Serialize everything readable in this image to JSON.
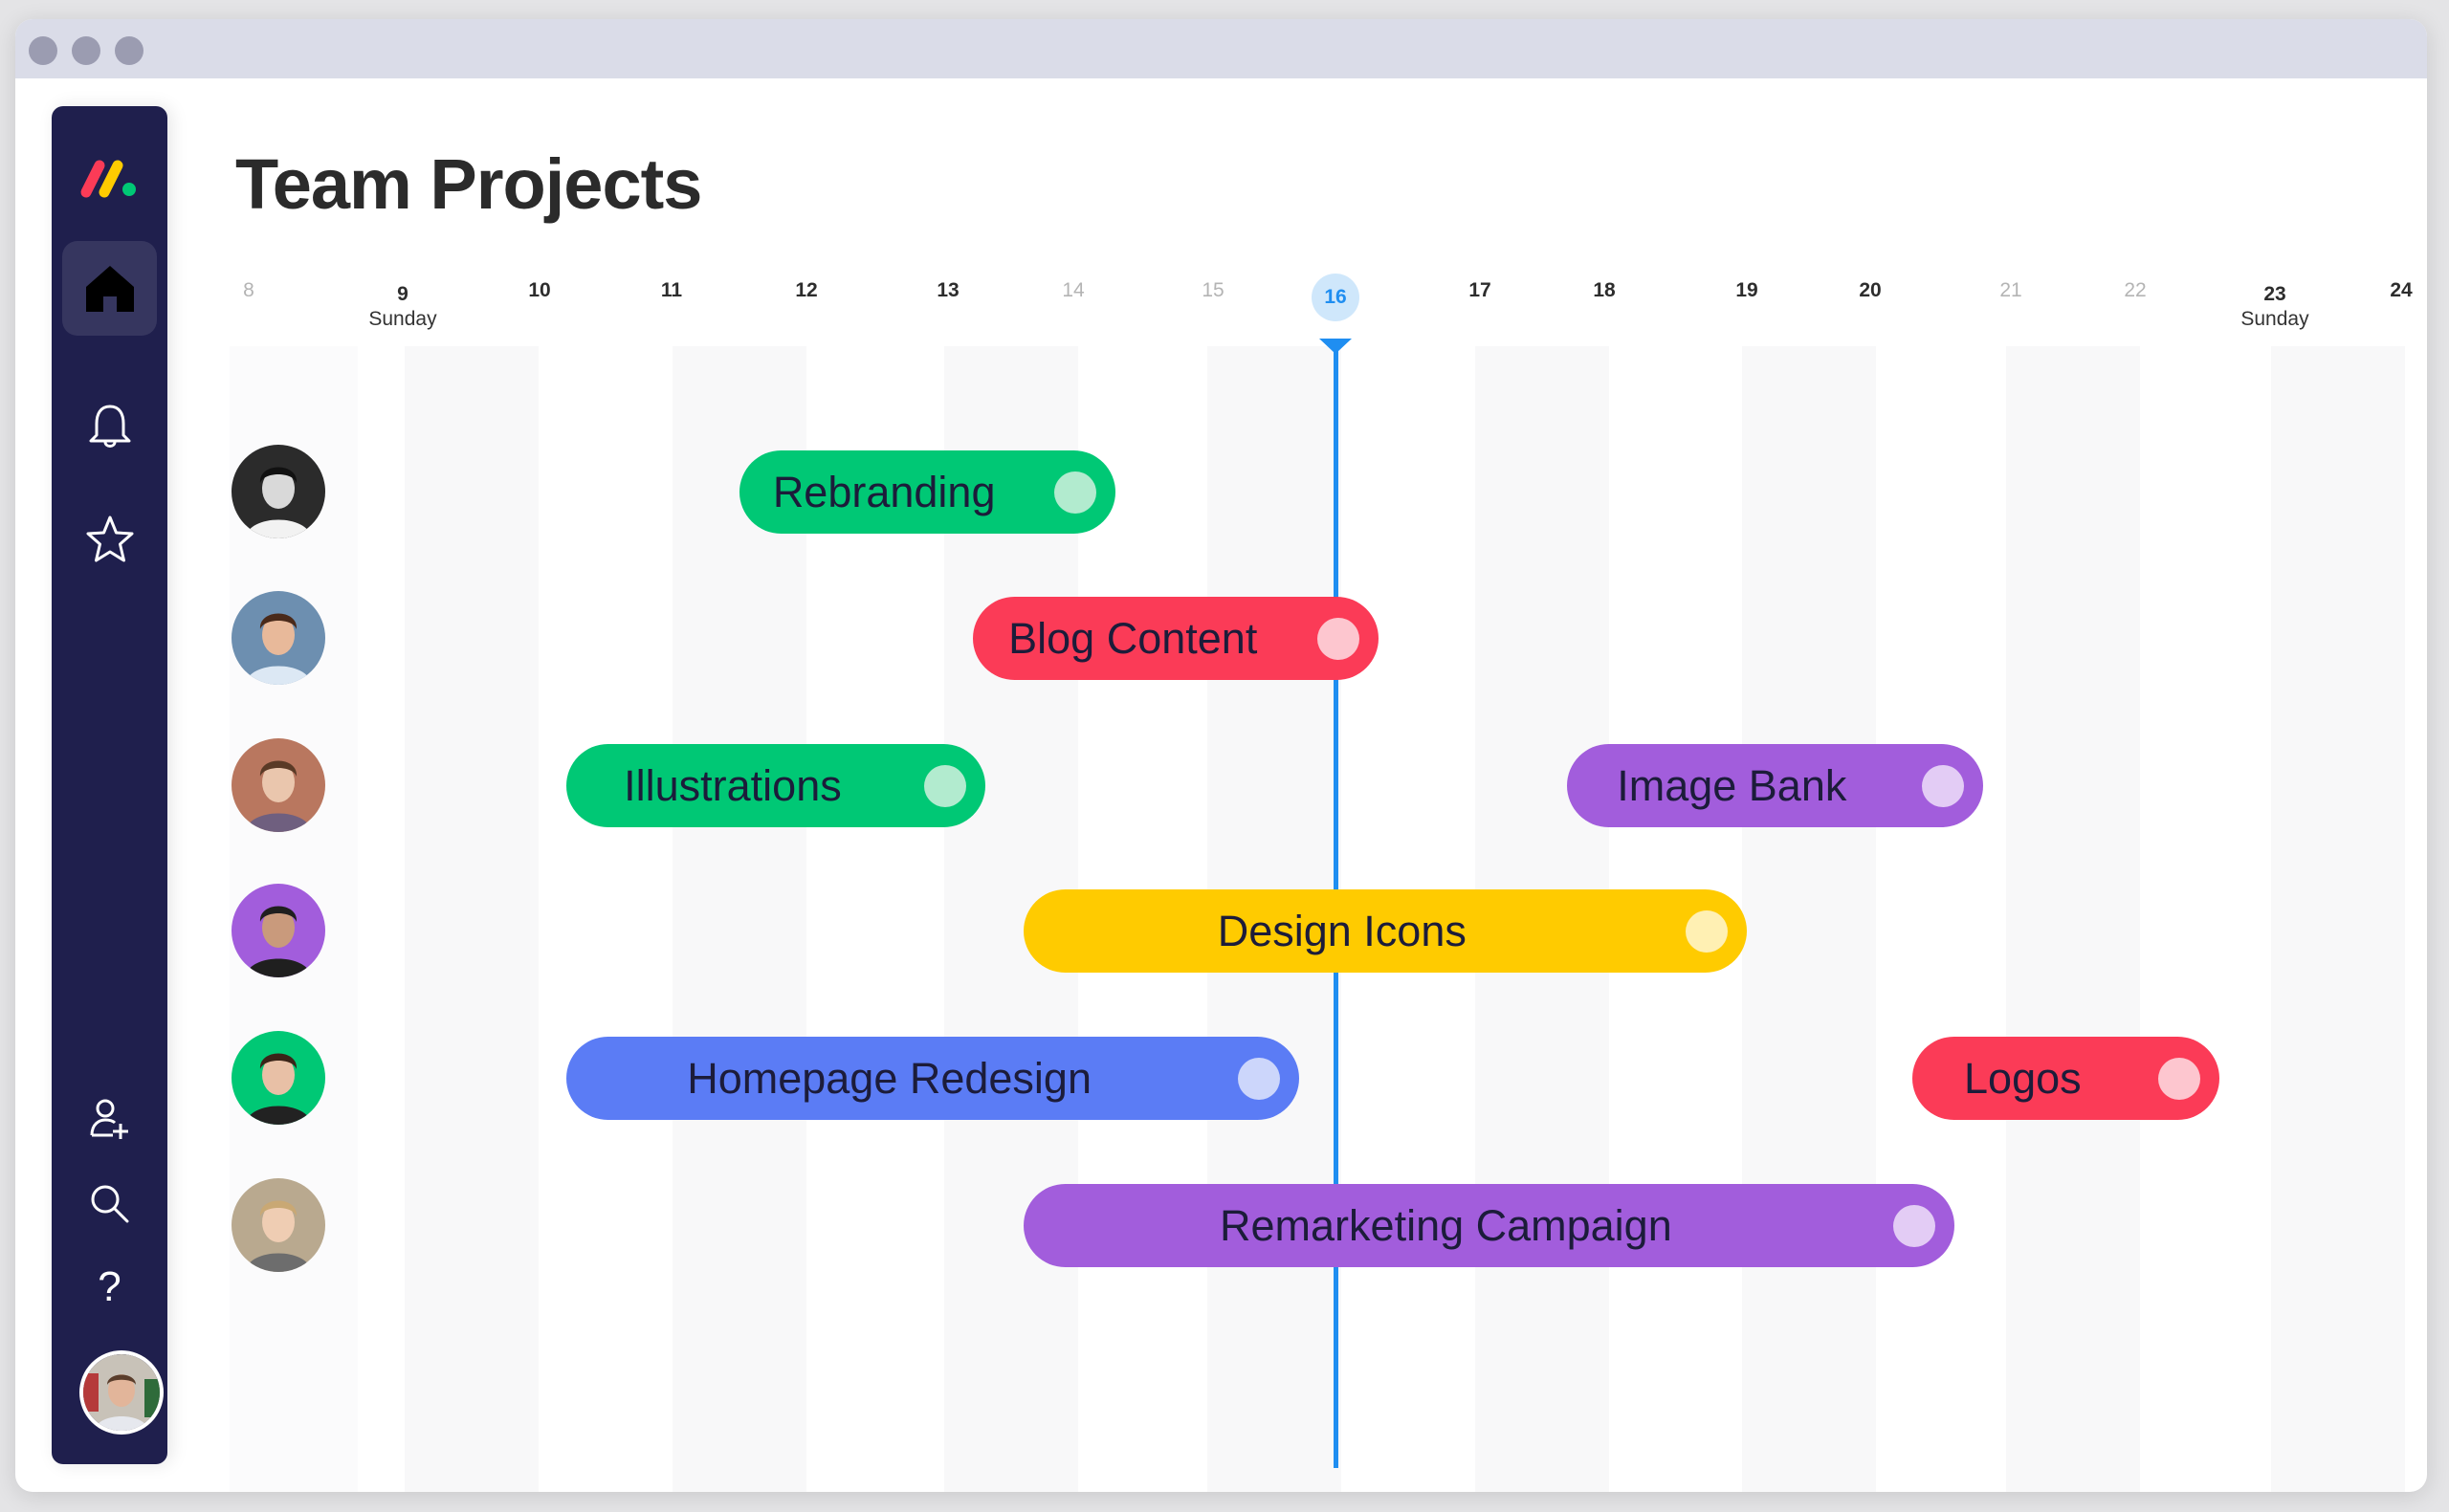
{
  "window": {
    "traffic_lights": [
      "close",
      "minimize",
      "maximize"
    ]
  },
  "sidebar": {
    "logo": "monday-logo",
    "top_items": [
      {
        "name": "home",
        "icon": "home-icon",
        "active": true
      },
      {
        "name": "notifications",
        "icon": "bell-icon",
        "active": false
      },
      {
        "name": "favorites",
        "icon": "star-icon",
        "active": false
      }
    ],
    "bottom_items": [
      {
        "name": "invite-members",
        "icon": "user-plus-icon"
      },
      {
        "name": "search",
        "icon": "search-icon"
      },
      {
        "name": "help",
        "icon": "help-icon",
        "glyph": "?"
      }
    ],
    "user_avatar": "current-user-avatar"
  },
  "header": {
    "title": "Team Projects"
  },
  "timeline": {
    "today": 16,
    "days": [
      {
        "day": "8",
        "sub": "",
        "muted": true
      },
      {
        "day": "9",
        "sub": "Sunday",
        "muted": false
      },
      {
        "day": "10",
        "sub": "",
        "muted": false
      },
      {
        "day": "11",
        "sub": "",
        "muted": false
      },
      {
        "day": "12",
        "sub": "",
        "muted": false
      },
      {
        "day": "13",
        "sub": "",
        "muted": false
      },
      {
        "day": "14",
        "sub": "",
        "muted": true
      },
      {
        "day": "15",
        "sub": "",
        "muted": true
      },
      {
        "day": "16",
        "sub": "",
        "muted": false,
        "today": true
      },
      {
        "day": "17",
        "sub": "",
        "muted": false
      },
      {
        "day": "18",
        "sub": "",
        "muted": false
      },
      {
        "day": "19",
        "sub": "",
        "muted": false
      },
      {
        "day": "20",
        "sub": "",
        "muted": false
      },
      {
        "day": "21",
        "sub": "",
        "muted": true
      },
      {
        "day": "22",
        "sub": "",
        "muted": true
      },
      {
        "day": "23",
        "sub": "Sunday",
        "muted": false
      },
      {
        "day": "24",
        "sub": "",
        "muted": false
      }
    ],
    "rows": [
      {
        "avatar": {
          "bg": "#2b2b2b",
          "skin": "#d9d9d9",
          "hair": "#111111",
          "shirt": "#f2f2f2"
        },
        "tasks": [
          {
            "label": "Rebranding",
            "start": 11.5,
            "end": 14.3,
            "color": "#00c875",
            "dot": "#b2ebcf"
          }
        ]
      },
      {
        "avatar": {
          "bg": "#6d8fb0",
          "skin": "#e8b99a",
          "hair": "#4a2a1a",
          "shirt": "#dce8f4"
        },
        "tasks": [
          {
            "label": "Blog Content",
            "start": 13.2,
            "end": 16.3,
            "color": "#fb3b57",
            "dot": "#fdc6cf"
          }
        ]
      },
      {
        "avatar": {
          "bg": "#b9775f",
          "skin": "#eac6ad",
          "hair": "#5a3a26",
          "shirt": "#6f5f7f"
        },
        "tasks": [
          {
            "label": "Illustrations",
            "start": 10.2,
            "end": 13.3,
            "color": "#00c875",
            "dot": "#b2ebcf"
          },
          {
            "label": "Image Bank",
            "start": 17.7,
            "end": 20.8,
            "color": "#a25ddc",
            "dot": "#e3ccf5"
          }
        ]
      },
      {
        "avatar": {
          "bg": "#a25ddc",
          "skin": "#c99a7c",
          "hair": "#1f1f1f",
          "shirt": "#1f1f1f"
        },
        "tasks": [
          {
            "label": "Design Icons",
            "start": 13.6,
            "end": 19.0,
            "color": "#ffcb00",
            "dot": "#fff0b3"
          }
        ]
      },
      {
        "avatar": {
          "bg": "#00c875",
          "skin": "#e8c0a6",
          "hair": "#3a2418",
          "shirt": "#222222"
        },
        "tasks": [
          {
            "label": "Homepage Redesign",
            "start": 10.2,
            "end": 15.7,
            "color": "#5b7cf5",
            "dot": "#ccd6fb"
          },
          {
            "label": "Logos",
            "start": 20.3,
            "end": 22.6,
            "color": "#fb3b57",
            "dot": "#fdc6cf"
          }
        ]
      },
      {
        "avatar": {
          "bg": "#b9a98f",
          "skin": "#efcdb3",
          "hair": "#c9a874",
          "shirt": "#6d6d6d"
        },
        "tasks": [
          {
            "label": "Remarketing Campaign",
            "start": 13.6,
            "end": 20.6,
            "color": "#a25ddc",
            "dot": "#e3ccf5"
          }
        ]
      }
    ]
  },
  "colors": {
    "sidebar_bg": "#1f1f4d",
    "today_accent": "#1f8ef1",
    "logo_red": "#fb3b57",
    "logo_yellow": "#ffcb00",
    "logo_green": "#00c875"
  }
}
